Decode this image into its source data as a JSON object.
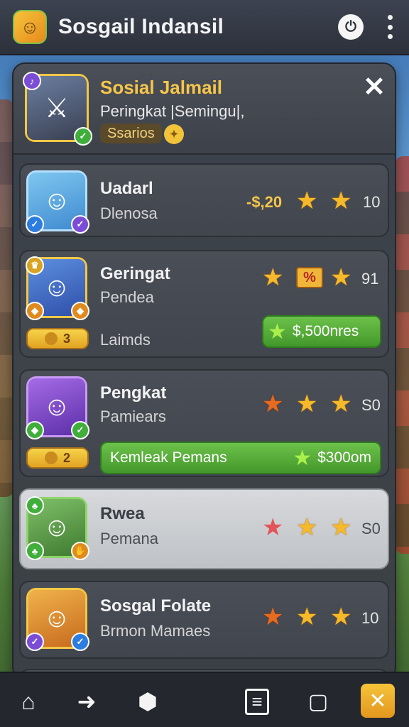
{
  "app": {
    "title": "Sosgail Indansil",
    "icon": "game-character-icon"
  },
  "header": {
    "title": "Sosial Jalmail",
    "subtitle": "Peringkat |Semingu|,",
    "pill": "Ssarios",
    "close_icon": "close-icon"
  },
  "rows": [
    {
      "name": "Uadarl",
      "sub": "Dlenosa",
      "price": "-$,20",
      "stars": [
        "gold",
        "gold"
      ],
      "count": "10"
    },
    {
      "name": "Geringat",
      "sub": "Pendea",
      "extra": "Laimds",
      "level": "3",
      "stars": [
        "gold",
        "gold"
      ],
      "discount": "%",
      "count": "91",
      "offer": "$,500nres"
    },
    {
      "name": "Pengkat",
      "sub": "Pamiears",
      "level": "2",
      "stars": [
        "orange",
        "gold",
        "gold"
      ],
      "count": "S0",
      "offer_label": "Kemleak Pemans",
      "offer": "$300om"
    },
    {
      "name": "Rwea",
      "sub": "Pemana",
      "stars": [
        "red",
        "gold",
        "gold"
      ],
      "count": "S0"
    },
    {
      "name": "Sosgal Folate",
      "sub": "Brmon Mamaes",
      "stars": [
        "orange",
        "gold",
        "gold"
      ],
      "count": "10"
    }
  ],
  "nav": [
    {
      "icon": "home-icon"
    },
    {
      "icon": "arrow-right-icon"
    },
    {
      "icon": "box-icon"
    },
    {
      "icon": "ticket-icon"
    },
    {
      "icon": "shop-bag-icon"
    },
    {
      "icon": "crossed-swords-icon",
      "active": true
    }
  ],
  "colors": {
    "accent": "#f6c64a",
    "panel": "#3a3e46",
    "green": "#4fae34"
  }
}
